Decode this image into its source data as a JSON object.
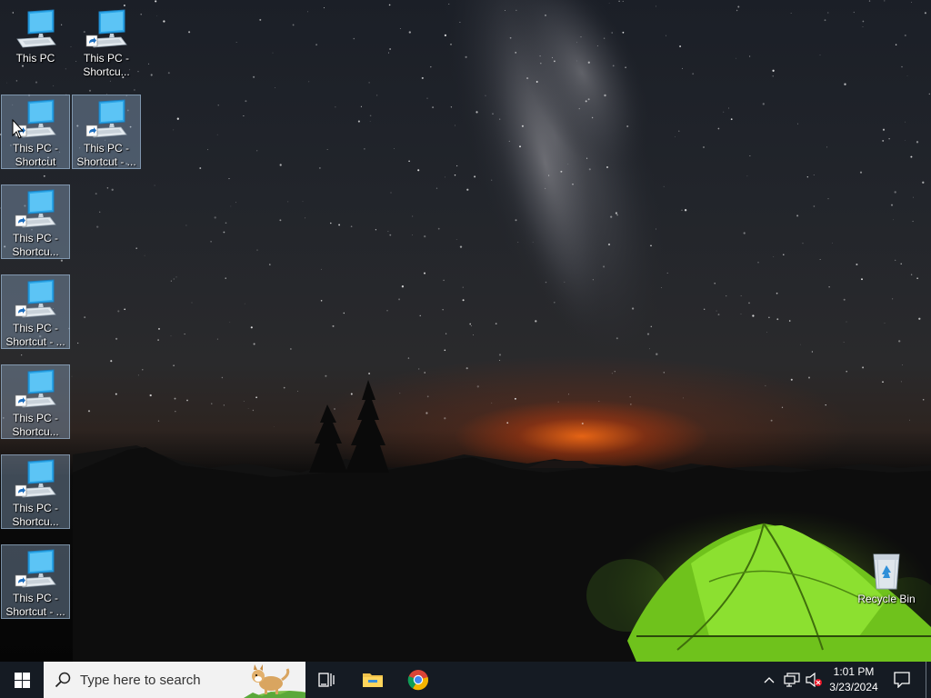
{
  "desktop": {
    "icons": [
      {
        "label": "This PC",
        "shortcut": false,
        "selected": false
      },
      {
        "label": "This PC - Shortcu...",
        "shortcut": true,
        "selected": false
      },
      {
        "label": "This PC - Shortcut",
        "shortcut": true,
        "selected": true
      },
      {
        "label": "This PC - Shortcut - ...",
        "shortcut": true,
        "selected": true
      },
      {
        "label": "This PC - Shortcu...",
        "shortcut": true,
        "selected": true
      },
      {
        "label": "This PC - Shortcut - ...",
        "shortcut": true,
        "selected": true
      },
      {
        "label": "This PC - Shortcu...",
        "shortcut": true,
        "selected": true
      },
      {
        "label": "This PC - Shortcu...",
        "shortcut": true,
        "selected": true
      },
      {
        "label": "This PC - Shortcut - ...",
        "shortcut": true,
        "selected": true
      }
    ],
    "recycle_bin": {
      "label": "Recycle Bin"
    }
  },
  "taskbar": {
    "start": {
      "icon": "windows-logo-icon"
    },
    "search": {
      "placeholder": "Type here to search",
      "icon": "search-icon"
    },
    "task_view": {
      "icon": "task-view-icon"
    },
    "pinned": [
      {
        "name": "file-explorer",
        "icon": "folder-icon"
      },
      {
        "name": "chrome",
        "icon": "chrome-icon"
      }
    ],
    "tray": {
      "chevron_icon": "chevron-up-icon",
      "network_icon": "network-icon",
      "volume_icon": "volume-muted-icon"
    },
    "clock": {
      "time": "1:01 PM",
      "date": "3/23/2024"
    },
    "notifications_icon": "action-center-icon"
  },
  "colors": {
    "taskbar": "#151b23",
    "selection": "#96b4d2",
    "monitor_blue": "#2ba6e8",
    "tent_green": "#7ed321"
  }
}
